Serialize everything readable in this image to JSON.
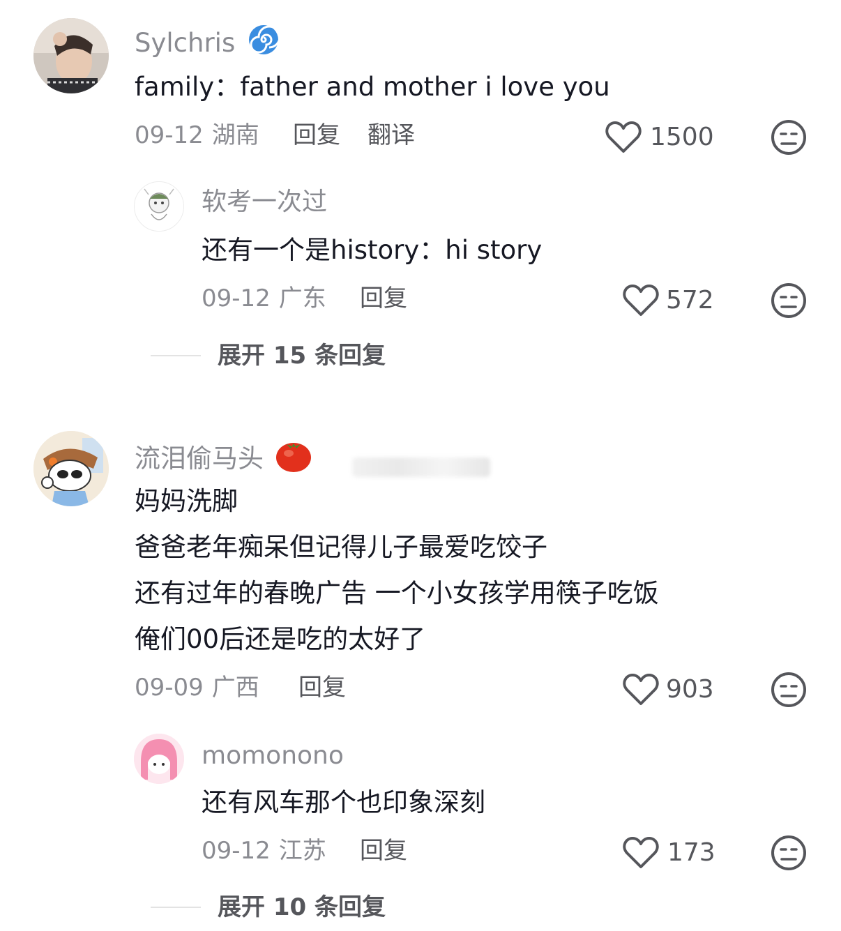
{
  "comments": [
    {
      "username": "Sylchris",
      "badge_icon": "spiral-badge-icon",
      "text": "family：father and mother i love you",
      "date": "09-12",
      "location": "湖南",
      "reply_label": "回复",
      "translate_label": "翻译",
      "likes": "1500",
      "replies": [
        {
          "username": "软考一次过",
          "text": "还有一个是history：hi  story",
          "date": "09-12",
          "location": "广东",
          "reply_label": "回复",
          "likes": "572"
        }
      ],
      "expand_label": "展开 15 条回复"
    },
    {
      "username": "流泪偷马头",
      "badge_icon": "tomato-badge-icon",
      "text_lines": [
        "妈妈洗脚",
        "爸爸老年痴呆但记得儿子最爱吃饺子",
        "还有过年的春晚广告 一个小女孩学用筷子吃饭",
        "俺们00后还是吃的太好了"
      ],
      "date": "09-09",
      "location": "广西",
      "reply_label": "回复",
      "likes": "903",
      "replies": [
        {
          "username": "momonono",
          "text": "还有风车那个也印象深刻",
          "date": "09-12",
          "location": "江苏",
          "reply_label": "回复",
          "likes": "173"
        }
      ],
      "expand_label": "展开 10 条回复"
    }
  ],
  "icons": {
    "like": "heart-outline-icon",
    "dislike": "meh-face-icon"
  },
  "colors": {
    "text_primary": "#161823",
    "text_secondary": "#8a8b91",
    "action": "#55565b"
  }
}
